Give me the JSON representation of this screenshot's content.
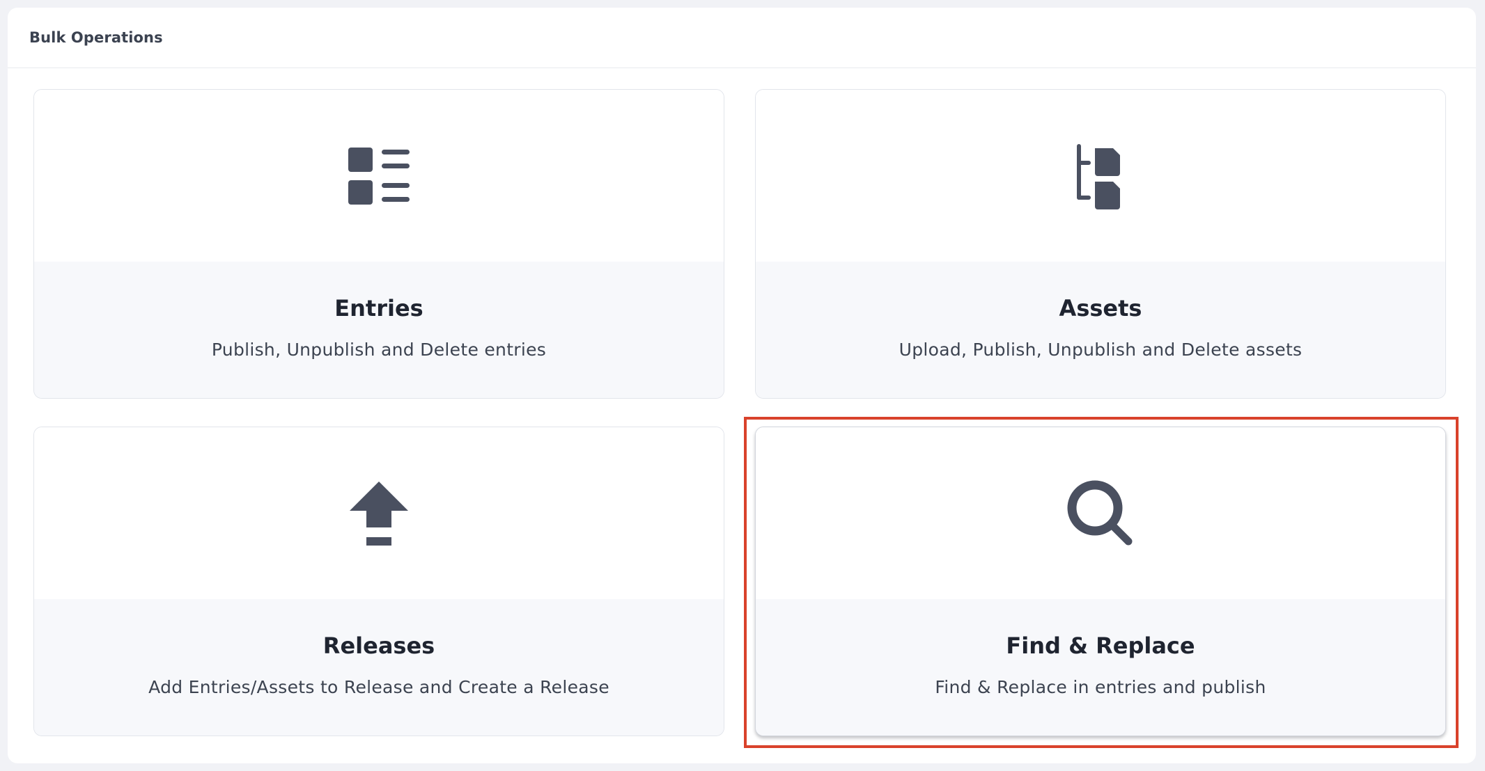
{
  "panel": {
    "title": "Bulk Operations"
  },
  "cards": [
    {
      "title": "Entries",
      "description": "Publish, Unpublish and Delete entries",
      "icon": "list-icon"
    },
    {
      "title": "Assets",
      "description": "Upload, Publish, Unpublish and Delete assets",
      "icon": "file-tree-icon"
    },
    {
      "title": "Releases",
      "description": "Add Entries/Assets to Release and Create a Release",
      "icon": "upload-arrow-icon"
    },
    {
      "title": "Find & Replace",
      "description": "Find & Replace in entries and publish",
      "icon": "search-icon",
      "selected": true
    }
  ],
  "colors": {
    "icon": "#4a5060",
    "highlight": "#d9422b",
    "card_footer_bg": "#f7f8fb"
  }
}
